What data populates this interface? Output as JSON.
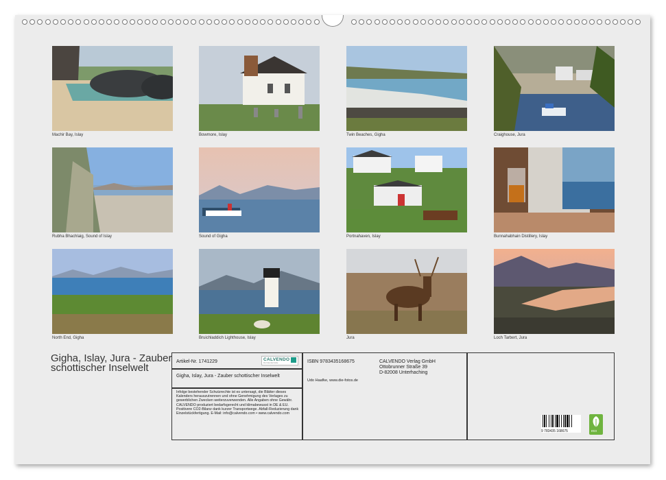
{
  "calendar": {
    "title": "Gigha, Islay, Jura - Zauber schottischer Inselwelt",
    "photos": [
      {
        "caption": "Machir Bay, Islay"
      },
      {
        "caption": "Bowmore, Islay"
      },
      {
        "caption": "Twin Beaches, Gigha"
      },
      {
        "caption": "Craighouse, Jura"
      },
      {
        "caption": "Rubha Bhachlaig, Sound of Islay"
      },
      {
        "caption": "Sound of Gigha"
      },
      {
        "caption": "Portnahaven, Islay"
      },
      {
        "caption": "Bunnahabhain Distillery, Islay"
      },
      {
        "caption": "North End, Gigha"
      },
      {
        "caption": "Bruichladdich Lighthouse, Islay"
      },
      {
        "caption": "Jura"
      },
      {
        "caption": "Loch Tarbert, Jura"
      }
    ]
  },
  "info": {
    "article": "Artikel-Nr. 1741229",
    "logo": "CALVENDO",
    "logo_sub": "Die Kalendermarke",
    "product_title": "Gigha, Islay, Jura - Zauber schottischer Inselwelt",
    "legal": "Infolge bestehender Schutzrechte ist es untersagt, die Blätter dieses Kalenders herauszutrennen und ohne Genehmigung des Verlages zu gewerblichen Zwecken weiterzuverwenden. Alle Angaben ohne Gewähr. CALVENDO produziert bedarfsgerecht und klimabewusst in DE & EU. Positivere CO2-Bilanz dank kurzer Transportwege. Abfall-Reduzierung dank Einzelstückfertigung. E-Mail: info@calvendo.com • www.calvendo.com",
    "isbn": "ISBN 9783435168675",
    "author": "Udo Haafke, www.die-fotos.de",
    "publisher_name": "CALVENDO Verlag GmbH",
    "publisher_street": "Ottobrunner Straße 39",
    "publisher_city": "D-82008 Unterhaching",
    "barcode_number": "9 783435 168675",
    "eco_label": "eco"
  }
}
